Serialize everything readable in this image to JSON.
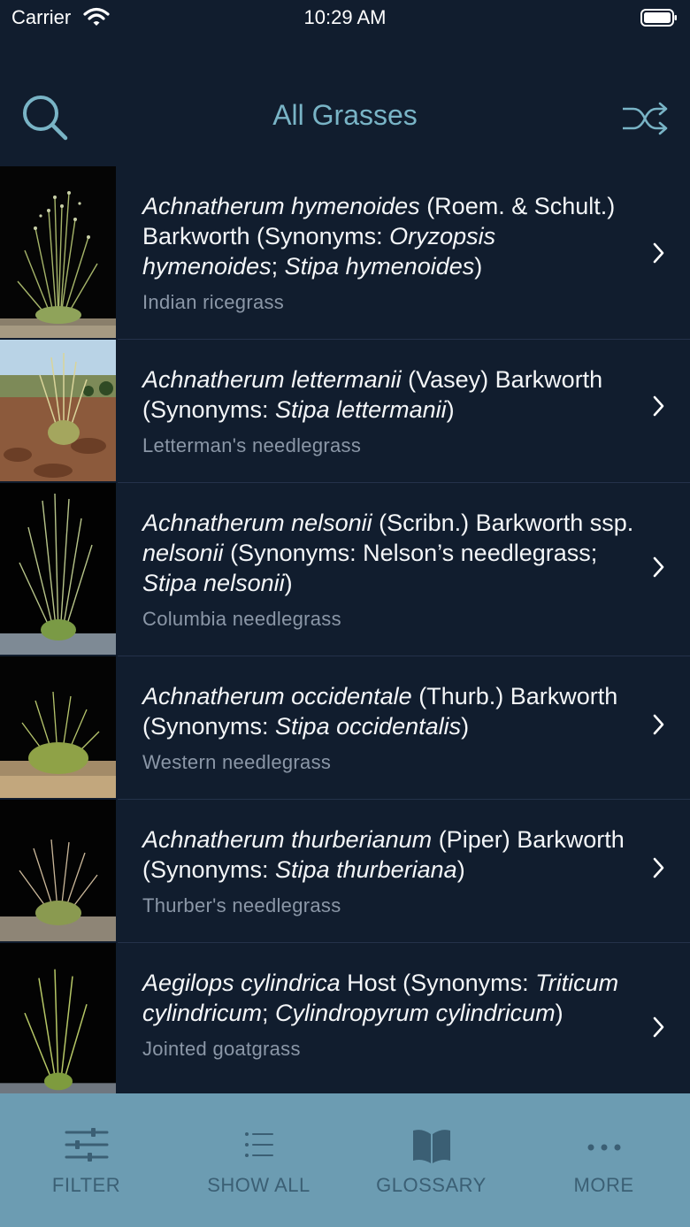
{
  "status_bar": {
    "carrier": "Carrier",
    "time": "10:29 AM"
  },
  "nav": {
    "title": "All Grasses",
    "left_icon": "search-icon",
    "right_icon": "shuffle-icon"
  },
  "colors": {
    "background": "#111d2e",
    "accent": "#79b4c6",
    "tab_bar": "#6c9cb2",
    "tab_label": "#3b5f74",
    "subtitle": "#8b97a7"
  },
  "grasses": [
    {
      "name_parts": [
        {
          "text": "Achnatherum hymenoides",
          "italic": true
        },
        {
          "text": " (Roem. & Schult.) Barkworth (Synonyms: ",
          "italic": false
        },
        {
          "text": "Oryzopsis hymenoides",
          "italic": true
        },
        {
          "text": "; ",
          "italic": false
        },
        {
          "text": "Stipa hymenoides",
          "italic": true
        },
        {
          "text": ")",
          "italic": false
        }
      ],
      "common_name": "Indian ricegrass"
    },
    {
      "name_parts": [
        {
          "text": "Achnatherum lettermanii",
          "italic": true
        },
        {
          "text": " (Vasey) Barkworth (Synonyms: ",
          "italic": false
        },
        {
          "text": "Stipa lettermanii",
          "italic": true
        },
        {
          "text": ")",
          "italic": false
        }
      ],
      "common_name": "Letterman's needlegrass"
    },
    {
      "name_parts": [
        {
          "text": "Achnatherum nelsonii",
          "italic": true
        },
        {
          "text": " (Scribn.) Barkworth ssp. ",
          "italic": false
        },
        {
          "text": "nelsonii",
          "italic": true
        },
        {
          "text": " (Synonyms: Nelson’s needlegrass; ",
          "italic": false
        },
        {
          "text": "Stipa nelsonii",
          "italic": true
        },
        {
          "text": ")",
          "italic": false
        }
      ],
      "common_name": "Columbia needlegrass"
    },
    {
      "name_parts": [
        {
          "text": "Achnatherum occidentale",
          "italic": true
        },
        {
          "text": " (Thurb.) Barkworth (Synonyms: ",
          "italic": false
        },
        {
          "text": "Stipa occidentalis",
          "italic": true
        },
        {
          "text": ")",
          "italic": false
        }
      ],
      "common_name": "Western needlegrass"
    },
    {
      "name_parts": [
        {
          "text": "Achnatherum thurberianum",
          "italic": true
        },
        {
          "text": " (Piper) Barkworth (Synonyms: ",
          "italic": false
        },
        {
          "text": "Stipa thurberiana",
          "italic": true
        },
        {
          "text": ")",
          "italic": false
        }
      ],
      "common_name": "Thurber's needlegrass"
    },
    {
      "name_parts": [
        {
          "text": "Aegilops cylindrica",
          "italic": true
        },
        {
          "text": " Host (Synonyms: ",
          "italic": false
        },
        {
          "text": "Triticum cylindricum",
          "italic": true
        },
        {
          "text": "; ",
          "italic": false
        },
        {
          "text": "Cylindropyrum cylindricum",
          "italic": true
        },
        {
          "text": ")",
          "italic": false
        }
      ],
      "common_name": "Jointed goatgrass"
    }
  ],
  "tabs": [
    {
      "label": "FILTER",
      "icon": "sliders-icon"
    },
    {
      "label": "SHOW ALL",
      "icon": "list-icon"
    },
    {
      "label": "GLOSSARY",
      "icon": "book-icon"
    },
    {
      "label": "MORE",
      "icon": "more-dots-icon"
    }
  ]
}
